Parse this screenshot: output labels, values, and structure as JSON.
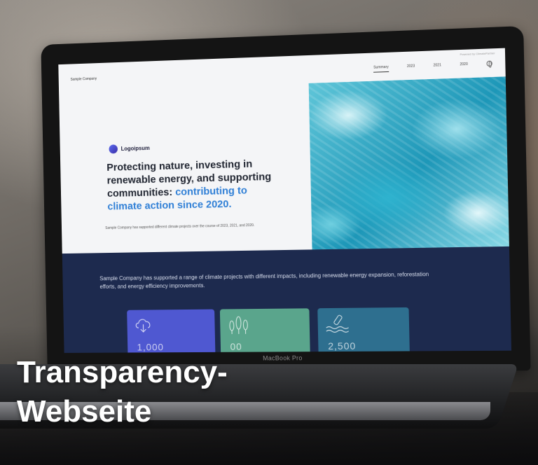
{
  "site": {
    "company_name": "Sample Company",
    "powered_by": "Powered by ClimatePartner",
    "nav": [
      {
        "label": "Summary",
        "active": true
      },
      {
        "label": "2023",
        "active": false
      },
      {
        "label": "2021",
        "active": false
      },
      {
        "label": "2020",
        "active": false
      }
    ],
    "logo_text": "Logoipsum",
    "headline_main": "Protecting nature, investing in renewable energy, and supporting communities: ",
    "headline_accent": "contributing to climate action since 2020.",
    "subcopy": "Sample Company has supported different climate projects over the course of 2023, 2021, and 2020.",
    "band_copy": "Sample Company has supported a range of climate projects with different impacts, including renewable energy expansion, reforestation efforts, and energy efficiency improvements.",
    "cards": [
      {
        "icon": "cloud-download-icon",
        "figure": "1,000"
      },
      {
        "icon": "trees-icon",
        "figure": "00"
      },
      {
        "icon": "water-bottle-icon",
        "figure": "2,500"
      }
    ]
  },
  "device_label": "MacBook Pro",
  "overlay_title": "Transparency-\nWebseite",
  "colors": {
    "accent_blue": "#2f7fd6",
    "band_navy": "#1d2a4e",
    "card_purple": "#4f58d1",
    "card_green": "#5aa58c",
    "card_teal": "#2e6f8f"
  }
}
